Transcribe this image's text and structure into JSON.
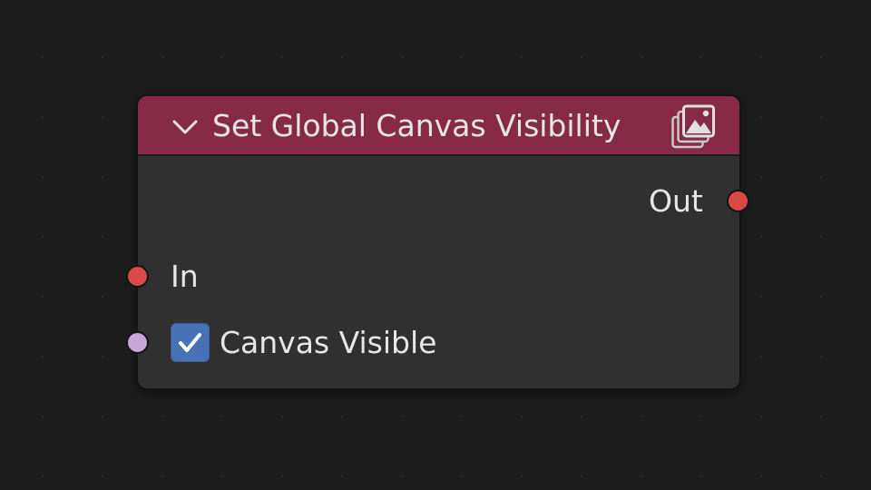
{
  "node": {
    "title": "Set Global Canvas Visibility",
    "header_color": "#862a48",
    "collapse_icon": "chevron-down-icon",
    "type_icon": "image-stack-icon",
    "outputs": [
      {
        "label": "Out",
        "socket_color": "#d94a46"
      }
    ],
    "inputs": [
      {
        "label": "In",
        "socket_color": "#d94a46"
      },
      {
        "label": "Canvas Visible",
        "socket_color": "#c9a6d8",
        "checked": true,
        "checkbox_color": "#4772b3"
      }
    ]
  }
}
